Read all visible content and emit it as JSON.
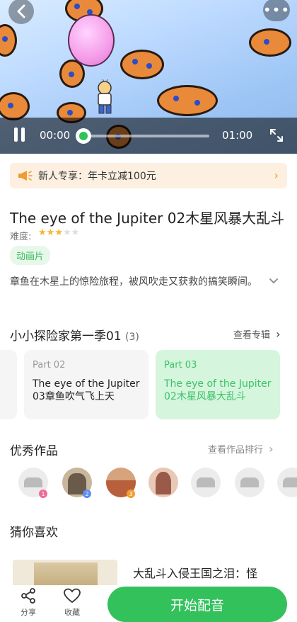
{
  "player": {
    "current_time": "00:00",
    "duration": "01:00",
    "progress_fraction": 0.0
  },
  "promo": {
    "text": "新人专享：年卡立减100元"
  },
  "episode": {
    "title": "The eye of the Jupiter 02木星风暴大乱斗",
    "difficulty_label": "难度:",
    "difficulty_stars": 3,
    "difficulty_max": 5,
    "tag": "动画片",
    "description": "章鱼在木星上的惊险旅程，被风吹走又获救的搞笑瞬间。"
  },
  "album": {
    "title": "小小探险家第一季01",
    "count": "(3)",
    "link": "查看专辑",
    "parts": [
      {
        "part": "Part 02",
        "title": "The eye of the Jupiter 03章鱼吹气飞上天",
        "active": false
      },
      {
        "part": "Part 03",
        "title": "The eye of the Jupiter 02木星风暴大乱斗",
        "active": true
      }
    ]
  },
  "works": {
    "title": "优秀作品",
    "link": "查看作品排行",
    "medals": [
      "1",
      "2",
      "3"
    ]
  },
  "recommend": {
    "title": "猜你喜欢",
    "items": [
      {
        "title": "大乱斗入侵王国之泪：怪"
      }
    ]
  },
  "bottom": {
    "share": "分享",
    "favorite": "收藏",
    "start": "开始配音"
  },
  "colors": {
    "accent": "#33c15b",
    "star": "#f5b82e",
    "promo_bg": "#fdf0e1",
    "promo_icon": "#f19b32"
  }
}
